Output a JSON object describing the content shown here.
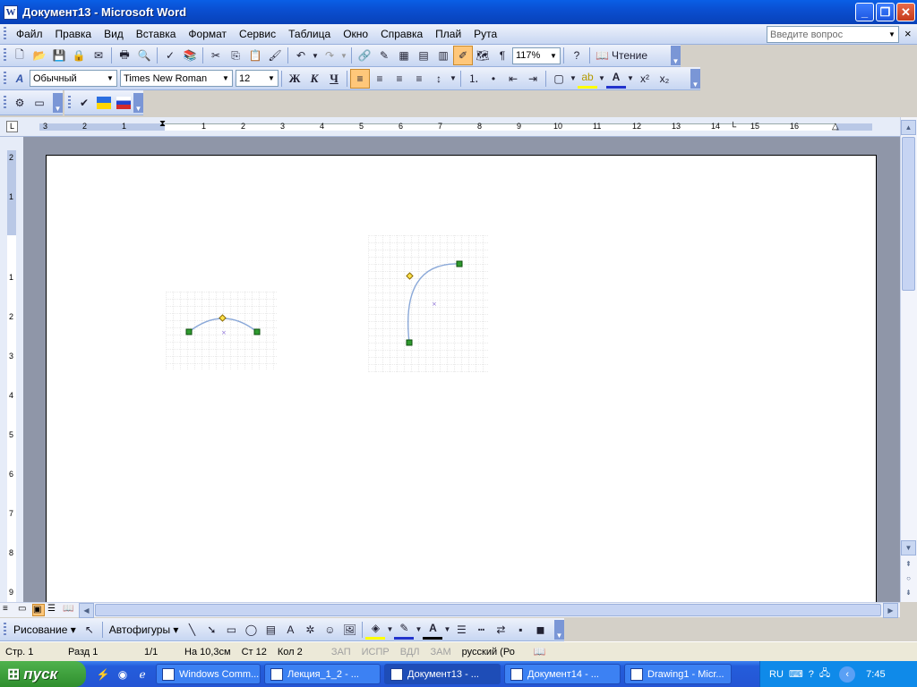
{
  "window": {
    "title": "Документ13 - Microsoft Word",
    "icon_letter": "W"
  },
  "menu": {
    "items": [
      "Файл",
      "Правка",
      "Вид",
      "Вставка",
      "Формат",
      "Сервис",
      "Таблица",
      "Окно",
      "Справка",
      "Плай",
      "Рута"
    ],
    "help_placeholder": "Введите вопрос",
    "close_doc": "×"
  },
  "standard_toolbar": {
    "zoom": "117%",
    "reading_label": "Чтение",
    "pilcrow": "¶"
  },
  "formatting_toolbar": {
    "style": "Обычный",
    "font": "Times New Roman",
    "size": "12",
    "bold": "Ж",
    "italic": "К",
    "underline": "Ч",
    "superscript": "x²",
    "subscript": "x₂"
  },
  "ruler": {
    "h_numbers": [
      "3",
      "2",
      "1",
      "1",
      "2",
      "3",
      "4",
      "5",
      "6",
      "7",
      "8",
      "9",
      "10",
      "11",
      "12",
      "13",
      "14",
      "15",
      "16"
    ],
    "v_numbers": [
      "2",
      "1",
      "1",
      "2",
      "3",
      "4",
      "5",
      "6",
      "7",
      "8",
      "9"
    ]
  },
  "drawing_toolbar": {
    "draw_label": "Рисование",
    "autoshapes_label": "Автофигуры"
  },
  "status": {
    "page": "Стр. 1",
    "section": "Разд 1",
    "pages": "1/1",
    "at": "На 10,3см",
    "line": "Ст 12",
    "col": "Кол 2",
    "rec": "ЗАП",
    "trk": "ИСПР",
    "ext": "ВДЛ",
    "ovr": "ЗАМ",
    "lang": "русский (Ро"
  },
  "taskbar": {
    "start": "пуск",
    "tasks": [
      "Windows Comm...",
      "Лекция_1_2 - ...",
      "Документ13 - ...",
      "Документ14 - ...",
      "Drawing1 - Micr..."
    ],
    "lang": "RU",
    "clock": "7:45"
  },
  "colors": {
    "accent": "#0a4fd1",
    "handle_green": "#2f9a2f",
    "handle_yellow": "#ffe14a",
    "curve": "#8aa8d8"
  }
}
